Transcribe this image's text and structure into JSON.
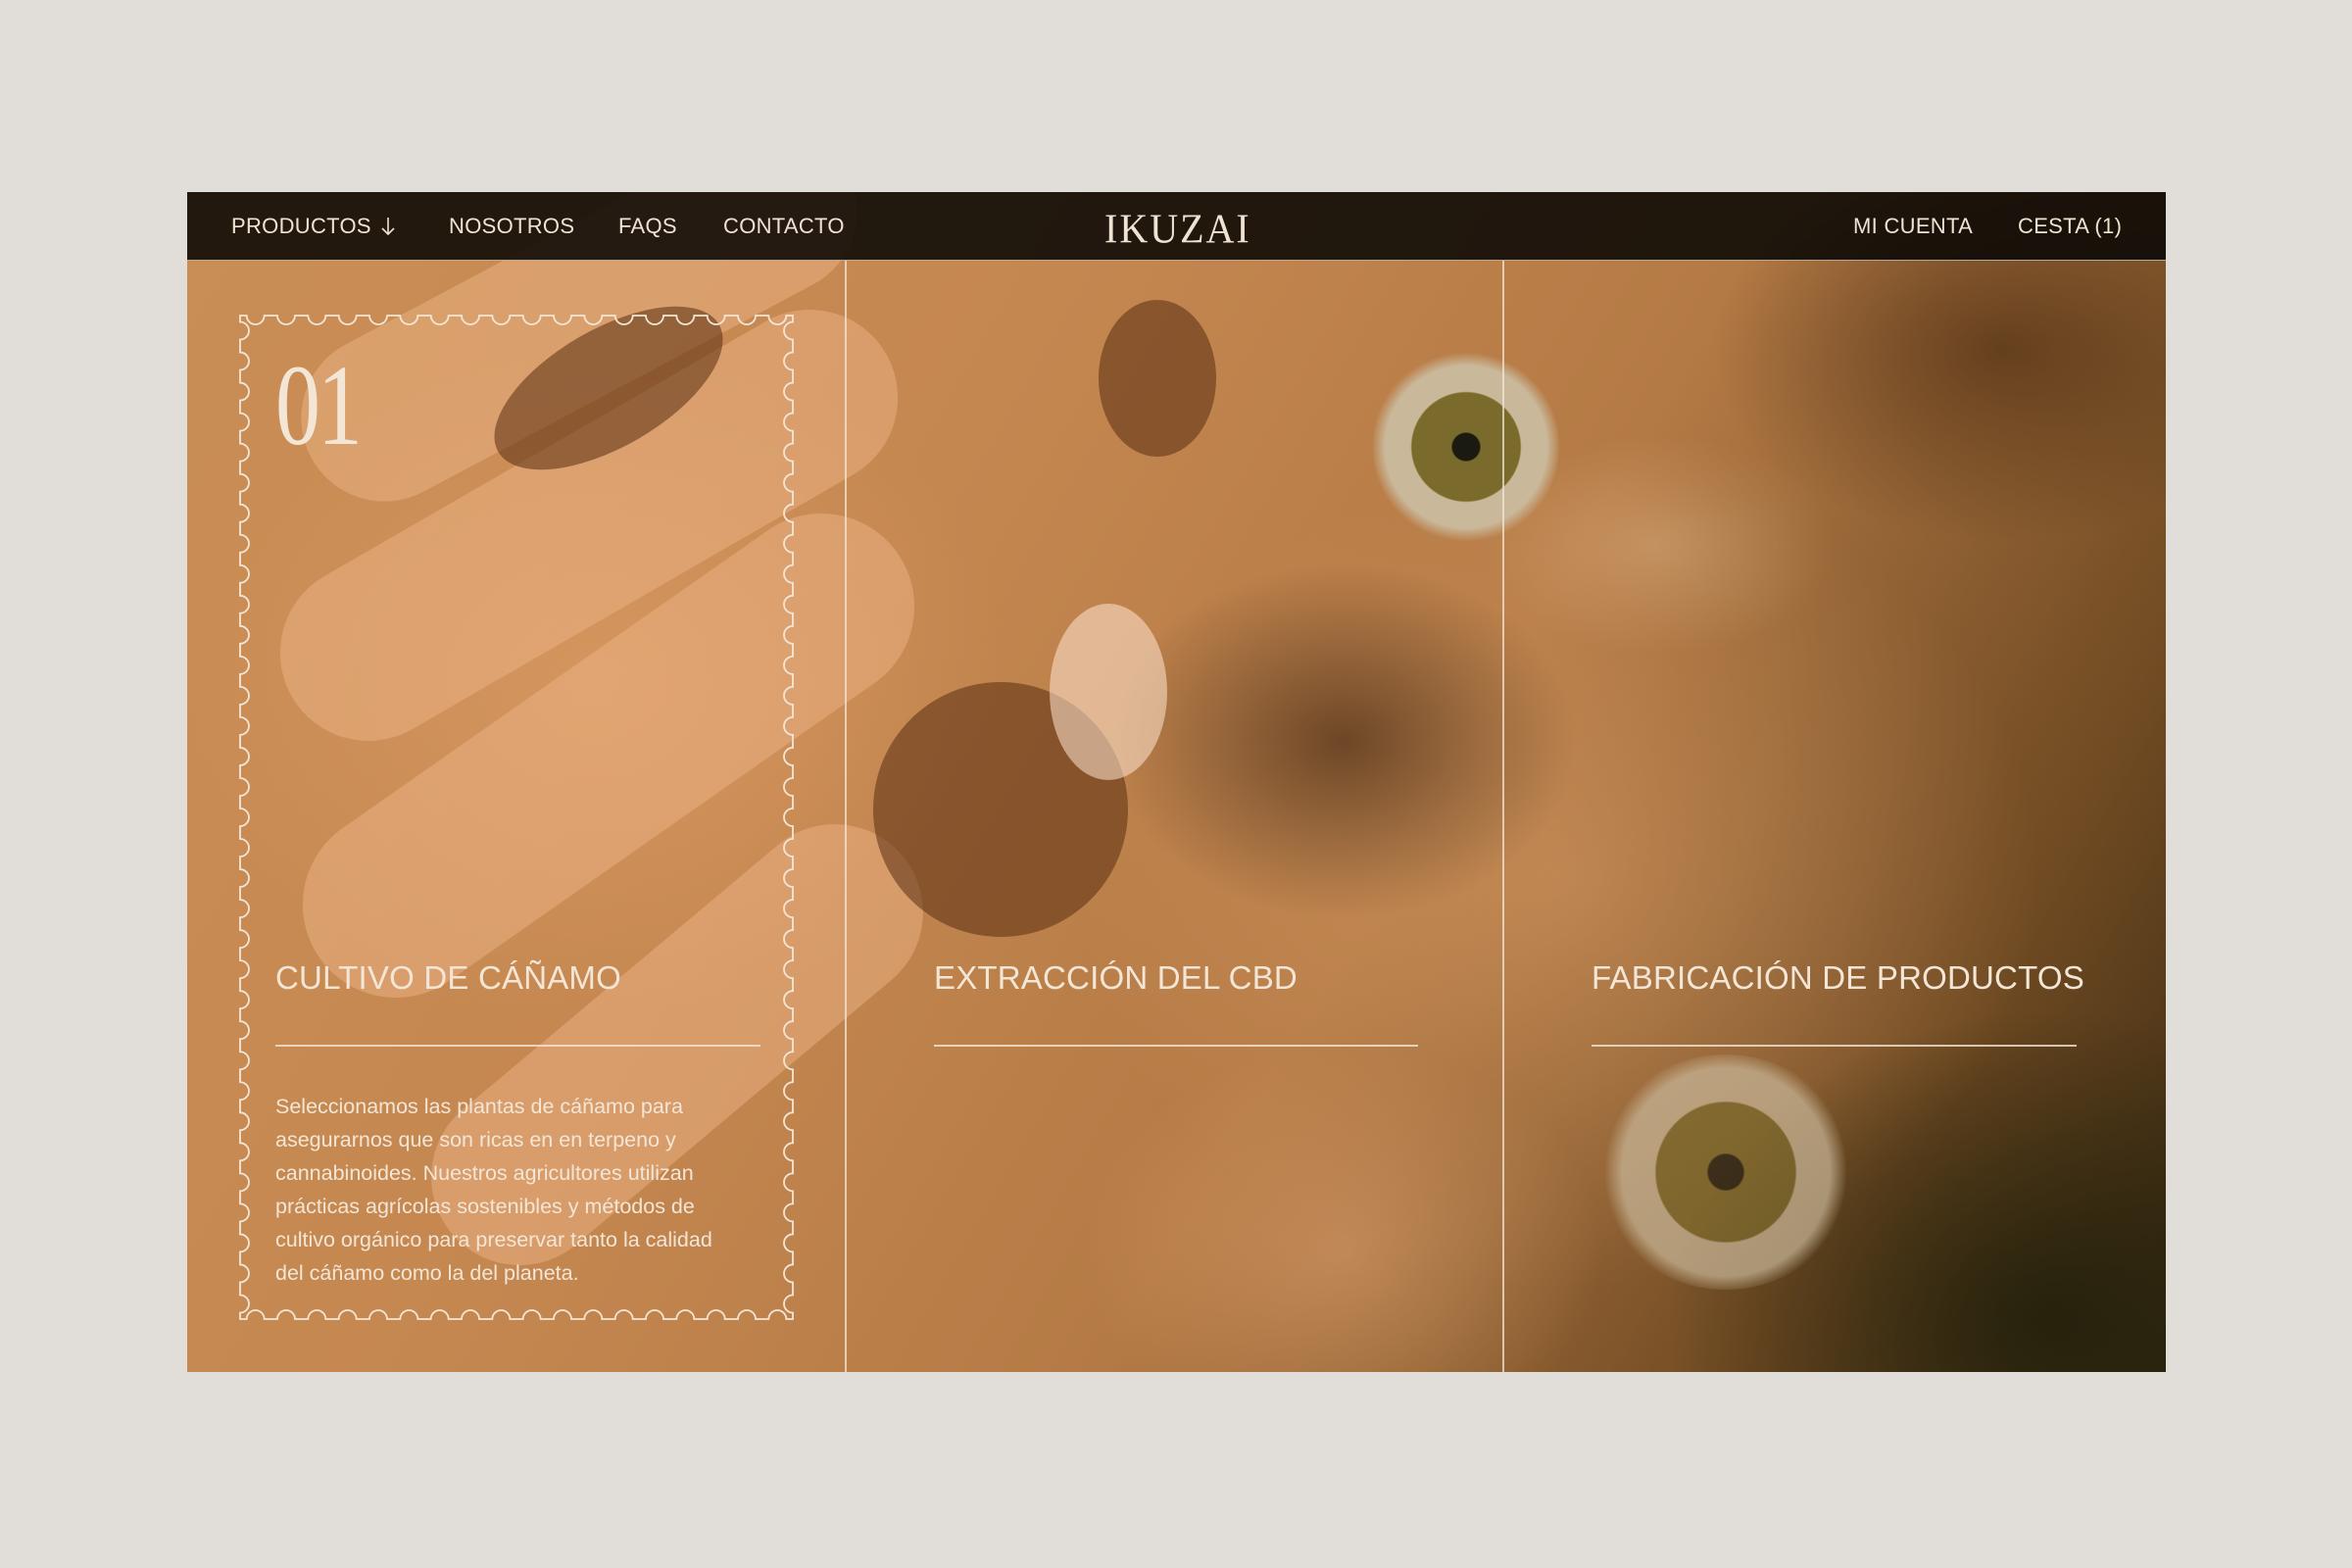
{
  "nav": {
    "left_items": [
      {
        "label": "PRODUCTOS",
        "icon": "arrow-down-icon"
      },
      {
        "label": "NOSOTROS"
      },
      {
        "label": "FAQS"
      },
      {
        "label": "CONTACTO"
      }
    ],
    "logo": "IKUZAI",
    "right_items": [
      {
        "label": "MI CUENTA"
      },
      {
        "label": "CESTA (1)"
      }
    ]
  },
  "steps": [
    {
      "number": "01",
      "title": "CULTIVO DE CÁÑAMO",
      "text": "Seleccionamos las plantas de cáñamo para asegurarnos que son ricas en en terpeno y cannabinoides. Nuestros agricultores utilizan prácticas agrícolas sostenibles y métodos de cultivo orgánico para preservar tanto la calidad del cáñamo como la del planeta."
    },
    {
      "title": "EXTRACCIÓN DEL CBD"
    },
    {
      "title": "FABRICACIÓN DE PRODUCTOS"
    }
  ],
  "colors": {
    "page_background": "#e1ddd9",
    "nav_background": "#0a0805",
    "text_cream": "#f3e6d6"
  }
}
